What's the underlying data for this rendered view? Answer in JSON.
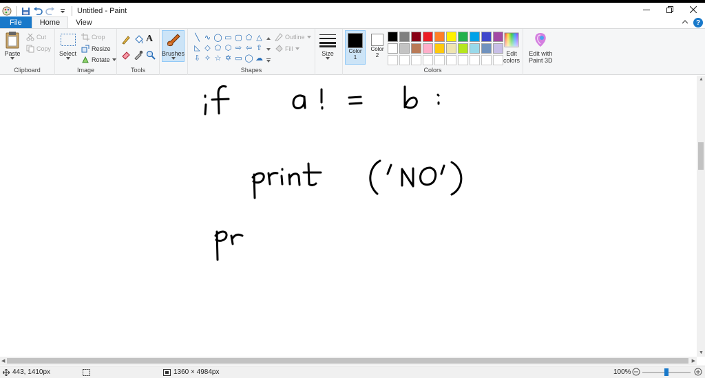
{
  "window": {
    "title": "Untitled - Paint",
    "controls": [
      "minimize-icon",
      "restore-icon",
      "close-icon"
    ]
  },
  "tabs": [
    {
      "label": "File"
    },
    {
      "label": "Home"
    },
    {
      "label": "View"
    }
  ],
  "ribbon": {
    "clipboard": {
      "label": "Clipboard",
      "paste": "Paste",
      "cut": "Cut",
      "copy": "Copy"
    },
    "image": {
      "label": "Image",
      "select": "Select",
      "crop": "Crop",
      "resize": "Resize",
      "rotate": "Rotate"
    },
    "tools": {
      "label": "Tools"
    },
    "brushes": {
      "label": "Brushes"
    },
    "shapes": {
      "label": "Shapes",
      "outline": "Outline",
      "fill": "Fill"
    },
    "size": {
      "label": "Size"
    },
    "colors": {
      "label": "Colors",
      "color1": "Color",
      "color1_num": "1",
      "color2": "Color",
      "color2_num": "2",
      "edit_colors_1": "Edit",
      "edit_colors_2": "colors",
      "paint3d_1": "Edit with",
      "paint3d_2": "Paint 3D",
      "color1_value": "#000000",
      "color2_value": "#ffffff",
      "palette_row1": [
        "#000000",
        "#7f7f7f",
        "#880015",
        "#ed1c24",
        "#ff7f27",
        "#fff200",
        "#22b14c",
        "#00a2e8",
        "#3f48cc",
        "#a349a4"
      ],
      "palette_row2": [
        "#ffffff",
        "#c3c3c3",
        "#b97a57",
        "#ffaec9",
        "#ffc90e",
        "#efe4b0",
        "#b5e61d",
        "#99d9ea",
        "#7092be",
        "#c8bfe7"
      ]
    }
  },
  "status": {
    "cursor_pos": "443, 1410px",
    "canvas_size": "1360 × 4984px",
    "zoom": "100%",
    "zoom_level": 0.5
  }
}
